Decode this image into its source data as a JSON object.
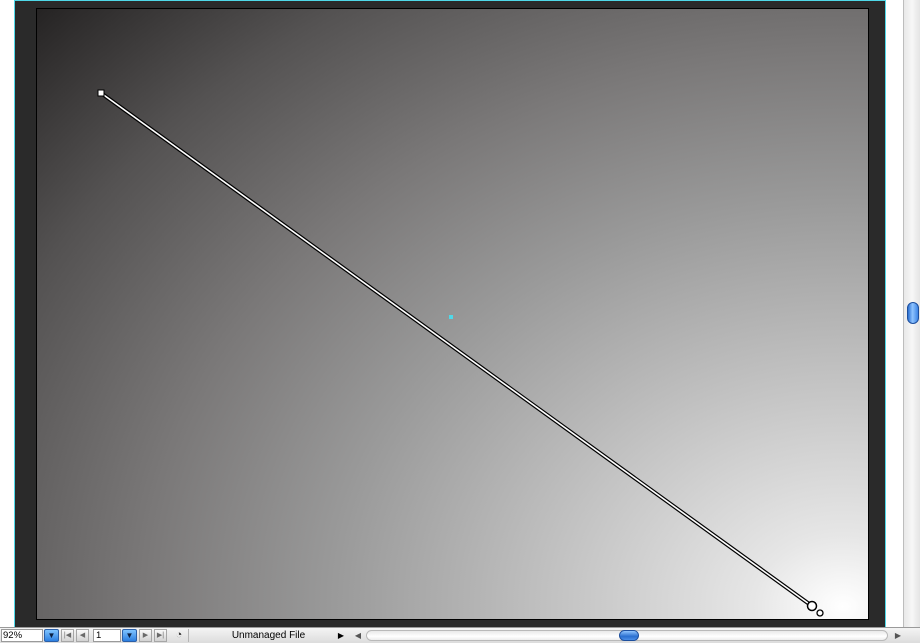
{
  "document": {
    "gradient_colors": {
      "dark": "#1e1c1c",
      "mid": "#9a9a9a",
      "light": "#ffffff"
    },
    "page_edge_color": "#4fd8e8",
    "center_marker_color": "#4fd8e8"
  },
  "statusbar": {
    "zoom_value": "92%",
    "zoom_dropdown_icon": "triangle-down-icon",
    "first_page_icon": "first-page-icon",
    "prev_page_icon": "prev-page-icon",
    "page_value": "1",
    "page_dropdown_icon": "triangle-down-icon",
    "next_page_icon": "next-page-icon",
    "last_page_icon": "last-page-icon",
    "file_status_icon": "version-cue-icon",
    "file_status": "Unmanaged File",
    "status_menu_icon": "triangle-right-icon",
    "scroll_left_icon": "arrow-left-icon",
    "scroll_right_icon": "arrow-right-icon"
  },
  "icons": {
    "triangle_down": "▼",
    "first": "|◀",
    "prev": "◀",
    "next": "▶",
    "last": "▶|",
    "version": "◔",
    "menu": "▶",
    "left": "◀",
    "right": "▶"
  }
}
